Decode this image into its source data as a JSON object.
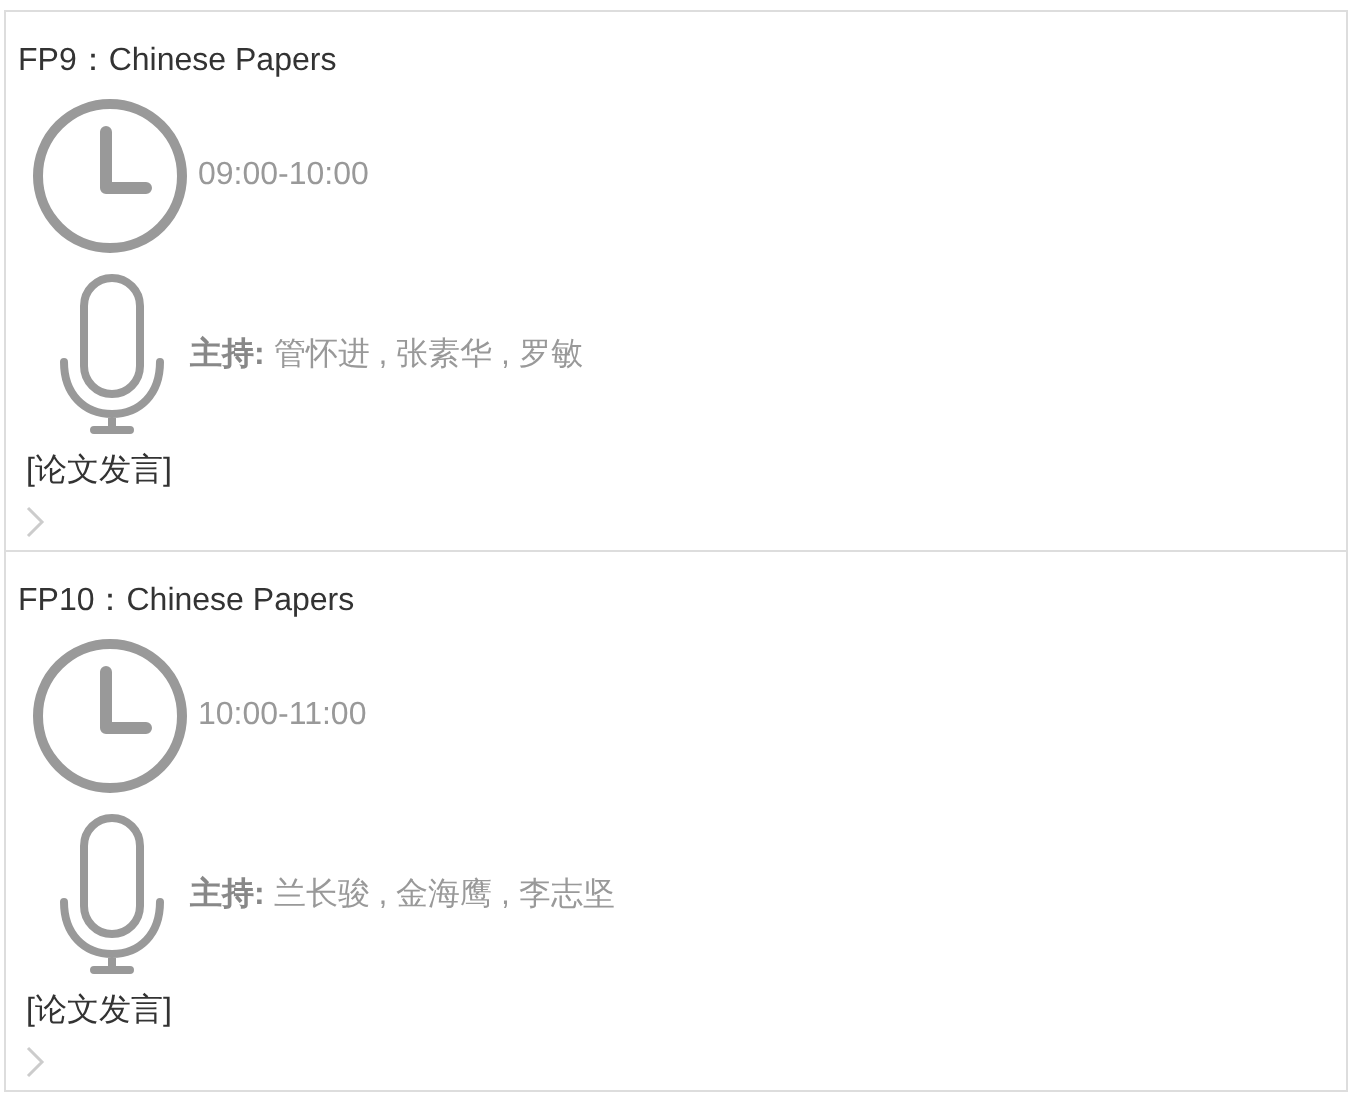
{
  "sessions": [
    {
      "title": "FP9：Chinese Papers",
      "time": "09:00-10:00",
      "hosts": "**主持:** 管怀进 , 张素华 , 罗敏",
      "tag": "[论文发言]"
    },
    {
      "title": "FP10：Chinese Papers",
      "time": "10:00-11:00",
      "hosts": "**主持:** 兰长骏 , 金海鹰 , 李志坚",
      "tag": "[论文发言]"
    }
  ]
}
